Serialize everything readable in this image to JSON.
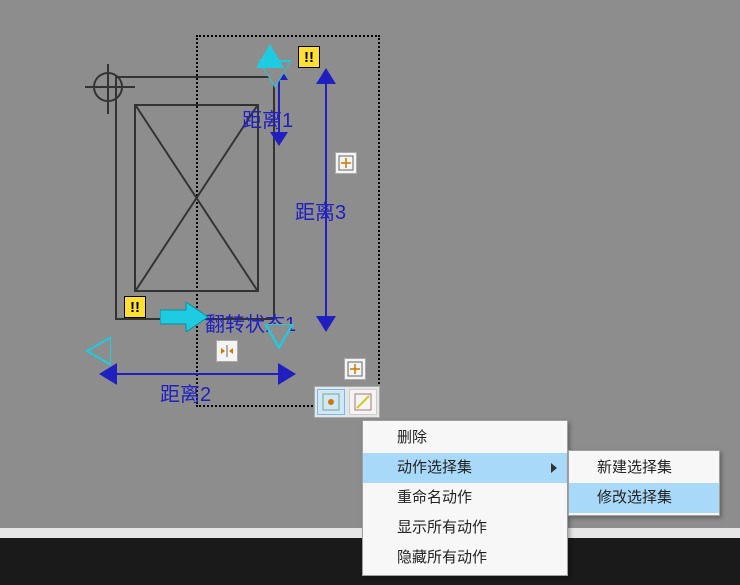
{
  "labels": {
    "distance1": "距离1",
    "distance2": "距离2",
    "distance3": "距离3",
    "flip_state1": "翻转状态1"
  },
  "warning_badges": {
    "b1": "!!",
    "b2": "!!"
  },
  "context_menu": {
    "items": {
      "delete": "删除",
      "action_selection": "动作选择集",
      "rename_action": "重命名动作",
      "show_all_actions": "显示所有动作",
      "hide_all_actions": "隐藏所有动作"
    },
    "highlight": "action_selection"
  },
  "submenu": {
    "items": {
      "new_selection_set": "新建选择集",
      "modify_selection_set": "修改选择集"
    },
    "highlight": "modify_selection_set"
  },
  "icons": {
    "warning": "warning-icon",
    "action1": "stretch-action-icon",
    "action2": "flip-action-icon",
    "btn_left": "tool-button-1",
    "btn_right": "tool-button-2"
  }
}
